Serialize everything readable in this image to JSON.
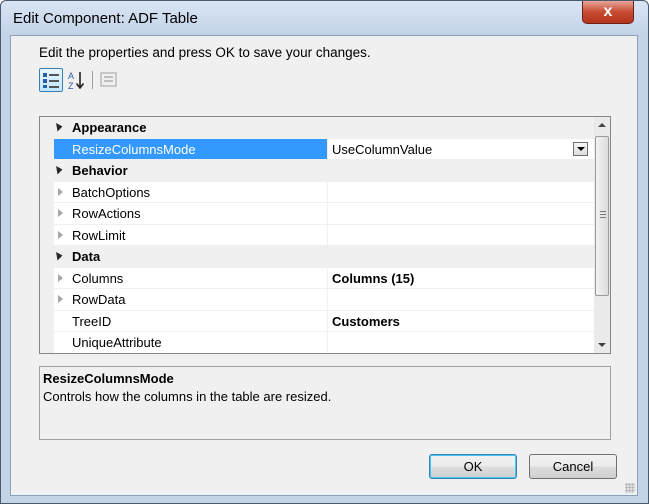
{
  "window": {
    "title": "Edit Component: ADF Table",
    "close_label": "x"
  },
  "instructions": "Edit the properties and press OK to save your changes.",
  "toolbar": {
    "categorized_icon": "categorized-icon",
    "alphabetical_icon": "sort-az-icon",
    "property_pages_icon": "property-pages-icon"
  },
  "grid": {
    "rows": [
      {
        "kind": "category",
        "label": "Appearance"
      },
      {
        "kind": "property",
        "label": "ResizeColumnsMode",
        "value": "UseColumnValue",
        "selected": true,
        "dropdown": true
      },
      {
        "kind": "category",
        "label": "Behavior"
      },
      {
        "kind": "property",
        "label": "BatchOptions",
        "value": "",
        "expandable": true
      },
      {
        "kind": "property",
        "label": "RowActions",
        "value": "",
        "expandable": true
      },
      {
        "kind": "property",
        "label": "RowLimit",
        "value": "",
        "expandable": true
      },
      {
        "kind": "category",
        "label": "Data"
      },
      {
        "kind": "property",
        "label": "Columns",
        "value": "Columns (15)",
        "expandable": true,
        "bold": true
      },
      {
        "kind": "property",
        "label": "RowData",
        "value": "",
        "expandable": true
      },
      {
        "kind": "property",
        "label": "TreeID",
        "value": "Customers",
        "bold": true
      },
      {
        "kind": "property",
        "label": "UniqueAttribute",
        "value": ""
      }
    ]
  },
  "description": {
    "title": "ResizeColumnsMode",
    "text": "Controls how the columns in the table are resized."
  },
  "buttons": {
    "ok": "OK",
    "cancel": "Cancel"
  }
}
